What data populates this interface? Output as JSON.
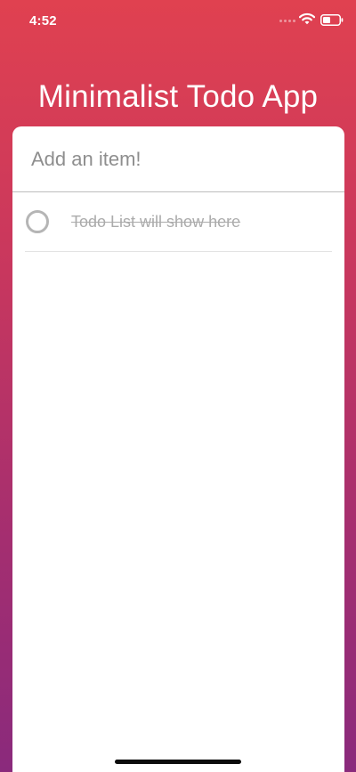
{
  "status_bar": {
    "time": "4:52",
    "icons": [
      "signal-dots-icon",
      "wifi-icon",
      "battery-icon"
    ]
  },
  "header": {
    "title": "Minimalist Todo App"
  },
  "add_item": {
    "placeholder": "Add an item!",
    "value": ""
  },
  "todos": [
    {
      "text": "Todo List will show here",
      "completed": true
    }
  ],
  "colors": {
    "gradient_top": "#e04150",
    "gradient_bottom": "#8a2a7c",
    "card_background": "#ffffff",
    "completed_text": "#ababab",
    "checkbox_border": "#b5b5b5"
  }
}
